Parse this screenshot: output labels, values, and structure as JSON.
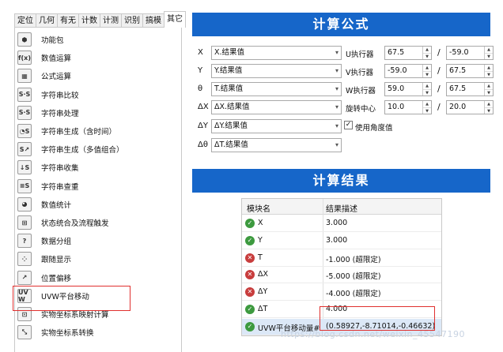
{
  "left": {
    "tabs": [
      "定位",
      "几何",
      "有无",
      "计数",
      "计测",
      "识别",
      "搞模",
      "其它"
    ],
    "active_tab": 7,
    "tools": [
      {
        "label": "功能包",
        "icon": "package-icon",
        "glyph": "⬢"
      },
      {
        "label": "数值运算",
        "icon": "function-icon",
        "glyph": "f(x)"
      },
      {
        "label": "公式运算",
        "icon": "calculator-icon",
        "glyph": "▦"
      },
      {
        "label": "字符串比较",
        "icon": "string-compare-icon",
        "glyph": "S·S"
      },
      {
        "label": "字符串处理",
        "icon": "string-process-icon",
        "glyph": "S·S"
      },
      {
        "label": "字符串生成（含时间）",
        "icon": "string-time-icon",
        "glyph": "◔S"
      },
      {
        "label": "字符串生成（多值组合）",
        "icon": "string-combine-icon",
        "glyph": "S↗"
      },
      {
        "label": "字符串收集",
        "icon": "string-collect-icon",
        "glyph": "↓S"
      },
      {
        "label": "字符串查重",
        "icon": "string-dedupe-icon",
        "glyph": "≡S"
      },
      {
        "label": "数值统计",
        "icon": "statistics-icon",
        "glyph": "◕"
      },
      {
        "label": "状态统合及流程触发",
        "icon": "flow-trigger-icon",
        "glyph": "⊞"
      },
      {
        "label": "数据分组",
        "icon": "data-group-icon",
        "glyph": "?"
      },
      {
        "label": "跟随显示",
        "icon": "follow-display-icon",
        "glyph": "⁘"
      },
      {
        "label": "位置偏移",
        "icon": "position-offset-icon",
        "glyph": "↗"
      },
      {
        "label": "UVW平台移动",
        "icon": "uvw-platform-icon",
        "glyph": "UV W"
      },
      {
        "label": "实物坐标系映射计算",
        "icon": "coord-map-icon",
        "glyph": "⊡"
      },
      {
        "label": "实物坐标系转换",
        "icon": "coord-transform-icon",
        "glyph": "⤡"
      }
    ]
  },
  "formula": {
    "title": "计算公式",
    "rows": [
      {
        "label": "X",
        "combo": "X.结果值",
        "param": "U执行器",
        "a": "67.5",
        "b": "-59.0"
      },
      {
        "label": "Y",
        "combo": "Y.结果值",
        "param": "V执行器",
        "a": "-59.0",
        "b": "67.5"
      },
      {
        "label": "θ",
        "combo": "T.结果值",
        "param": "W执行器",
        "a": "59.0",
        "b": "67.5"
      },
      {
        "label": "ΔX",
        "combo": "ΔX.结果值",
        "param": "旋转中心",
        "a": "10.0",
        "b": "20.0"
      },
      {
        "label": "ΔY",
        "combo": "ΔY.结果值",
        "checkbox_label": "使用角度值",
        "checked": "✓"
      },
      {
        "label": "Δθ",
        "combo": "ΔT.结果值"
      }
    ]
  },
  "results": {
    "title": "计算结果",
    "headers": {
      "name": "模块名",
      "desc": "结果描述"
    },
    "rows": [
      {
        "status": "ok",
        "name": "X",
        "desc": "3.000"
      },
      {
        "status": "ok",
        "name": "Y",
        "desc": "3.000"
      },
      {
        "status": "err",
        "name": "T",
        "desc": "-1.000 (超限定)"
      },
      {
        "status": "err",
        "name": "ΔX",
        "desc": "-5.000 (超限定)"
      },
      {
        "status": "err",
        "name": "ΔY",
        "desc": "-4.000 (超限定)"
      },
      {
        "status": "ok",
        "name": "ΔT",
        "desc": "4.000"
      },
      {
        "status": "ok",
        "name": "UVW平台移动量#",
        "desc": "(0.58927,-8.71014,-0.46632)"
      }
    ]
  },
  "watermark": "https://blog.csdn.net/weixin_45547190",
  "colors": {
    "header_bg": "#1666c9",
    "ok": "#3d9a3f",
    "err": "#c83d3d",
    "highlight": "#e0302e"
  }
}
